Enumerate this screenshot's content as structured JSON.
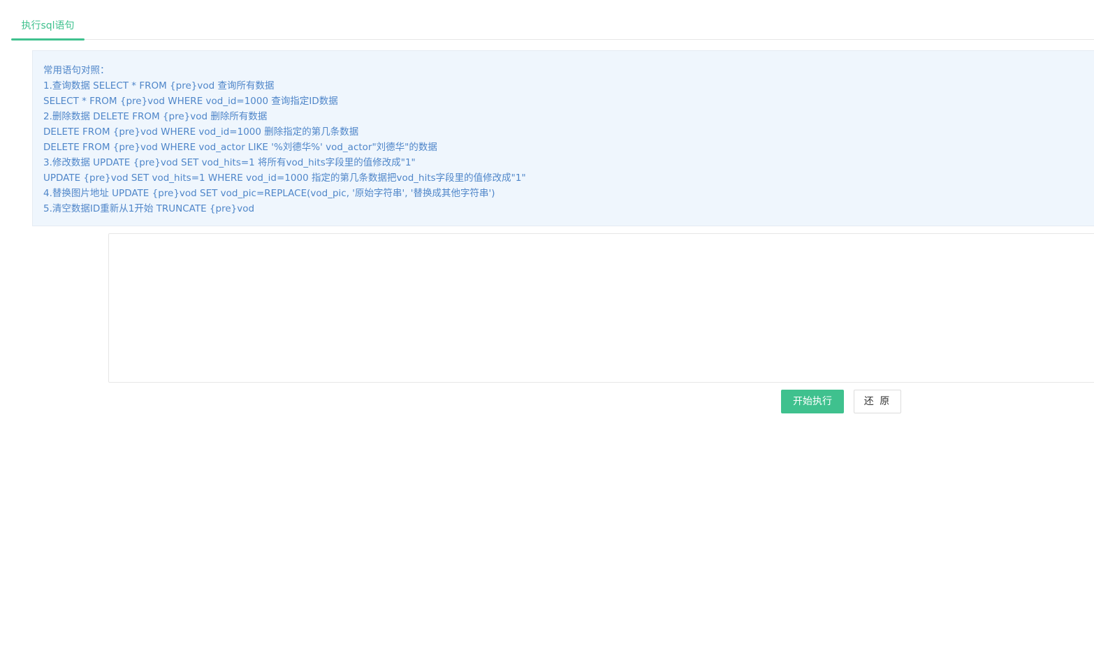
{
  "tabs": [
    {
      "label": "执行sql语句",
      "active": true
    }
  ],
  "tips": {
    "lines": [
      "常用语句对照：",
      "1.查询数据 SELECT * FROM {pre}vod 查询所有数据",
      "SELECT * FROM {pre}vod WHERE vod_id=1000 查询指定ID数据",
      "2.删除数据 DELETE FROM {pre}vod 删除所有数据",
      "DELETE FROM {pre}vod WHERE vod_id=1000 删除指定的第几条数据",
      "DELETE FROM {pre}vod WHERE vod_actor LIKE '%刘德华%' vod_actor\"刘德华\"的数据",
      "3.修改数据 UPDATE {pre}vod SET vod_hits=1 将所有vod_hits字段里的值修改成\"1\"",
      "UPDATE {pre}vod SET vod_hits=1 WHERE vod_id=1000 指定的第几条数据把vod_hits字段里的值修改成\"1\"",
      "4.替换图片地址 UPDATE {pre}vod SET vod_pic=REPLACE(vod_pic, '原始字符串', '替换成其他字符串')",
      "5.清空数据ID重新从1开始 TRUNCATE {pre}vod"
    ]
  },
  "sql_input": {
    "value": "",
    "placeholder": ""
  },
  "buttons": {
    "execute_label": "开始执行",
    "reset_label": "还 原"
  },
  "colors": {
    "accent": "#3fc18e",
    "tips_text": "#4f86c9",
    "tips_background": "#eff6fd"
  }
}
